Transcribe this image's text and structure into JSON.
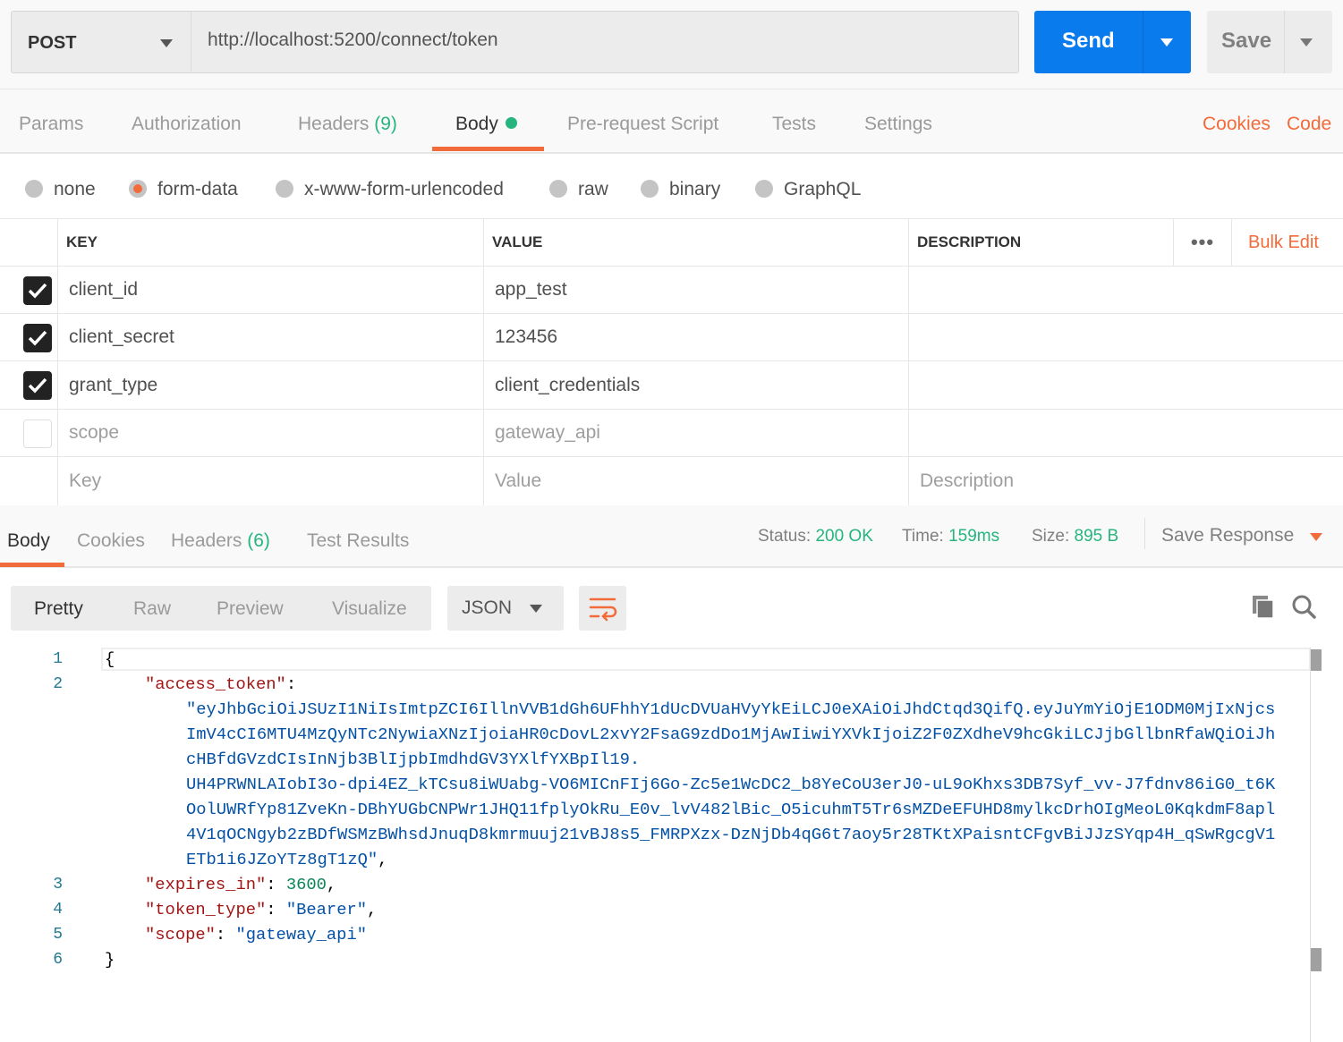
{
  "request": {
    "method": "POST",
    "url": "http://localhost:5200/connect/token",
    "send_label": "Send",
    "save_label": "Save"
  },
  "request_tabs": {
    "params": "Params",
    "authorization": "Authorization",
    "headers": "Headers",
    "headers_count": "(9)",
    "body": "Body",
    "prerequest": "Pre-request Script",
    "tests": "Tests",
    "settings": "Settings",
    "cookies": "Cookies",
    "code": "Code"
  },
  "body_types": {
    "options": [
      "none",
      "form-data",
      "x-www-form-urlencoded",
      "raw",
      "binary",
      "GraphQL"
    ],
    "selected": "form-data"
  },
  "form_table": {
    "headers": {
      "key": "KEY",
      "value": "VALUE",
      "description": "DESCRIPTION",
      "bulk_edit": "Bulk Edit"
    },
    "rows": [
      {
        "key": "client_id",
        "value": "app_test",
        "checked": true
      },
      {
        "key": "client_secret",
        "value": "123456",
        "checked": true
      },
      {
        "key": "grant_type",
        "value": "client_credentials",
        "checked": true
      },
      {
        "key": "scope",
        "value": "gateway_api",
        "checked": false
      }
    ],
    "placeholders": {
      "key": "Key",
      "value": "Value",
      "description": "Description"
    }
  },
  "response_tabs": {
    "body": "Body",
    "cookies": "Cookies",
    "headers": "Headers",
    "headers_count": "(6)",
    "test_results": "Test Results"
  },
  "response_status": {
    "status_label": "Status:",
    "status": "200 OK",
    "time_label": "Time:",
    "time": "159ms",
    "size_label": "Size:",
    "size": "895 B",
    "save_response": "Save Response"
  },
  "view_modes": {
    "pretty": "Pretty",
    "raw": "Raw",
    "preview": "Preview",
    "visualize": "Visualize",
    "format": "JSON"
  },
  "response_body": {
    "access_token_key": "access_token",
    "access_token_lines": [
      "eyJhbGciOiJSUzI1NiIsImtpZCI6IllnVVB1dGh6UFhhY1dUcDVUaHVyYkEiLCJ0eXAiOiJhdCtqd3QifQ.eyJuYmYiOjE1ODM0MjIxNjcs",
      "ImV4cCI6MTU4MzQyNTc2NywiaXNzIjoiaHR0cDovL2xvY2FsaG9zdDo1MjAwIiwiYXVkIjoiZ2F0ZXdheV9hcGkiLCJjbGllbnRfaWQiOiJh",
      "cHBfdGVzdCIsInNjb3BlIjpbImdhdGV3YXlfYXBpIl19.",
      "UH4PRWNLAIobI3o-dpi4EZ_kTCsu8iWUabg-VO6MICnFIj6Go-Zc5e1WcDC2_b8YeCoU3erJ0-uL9oKhxs3DB7Syf_vv-J7fdnv86iG0_t6K",
      "OolUWRfYp81ZveKn-DBhYUGbCNPWr1JHQ11fplyOkRu_E0v_lvV482lBic_O5icuhmT5Tr6sMZDeEFUHD8mylkcDrhOIgMeoL0KqkdmF8apl",
      "4V1qOCNgyb2zBDfWSMzBWhsdJnuqD8kmrmuuj21vBJ8s5_FMRPXzx-DzNjDb4qG6t7aoy5r28TKtXPaisntCFgvBiJJzSYqp4H_qSwRgcgV1",
      "ETb1i6JZoYTz8gT1zQ"
    ],
    "expires_in_key": "expires_in",
    "expires_in": "3600",
    "token_type_key": "token_type",
    "token_type": "Bearer",
    "scope_key": "scope",
    "scope": "gateway_api",
    "line_numbers": [
      "1",
      "2",
      "3",
      "4",
      "5",
      "6"
    ]
  },
  "colors": {
    "accent": "#f26b3a",
    "send": "#097bed",
    "success": "#26b47f"
  },
  "icons": [
    "chevron-down-icon",
    "checkbox-checked-icon",
    "more-icon",
    "wrap-icon",
    "copy-icon",
    "search-icon"
  ]
}
